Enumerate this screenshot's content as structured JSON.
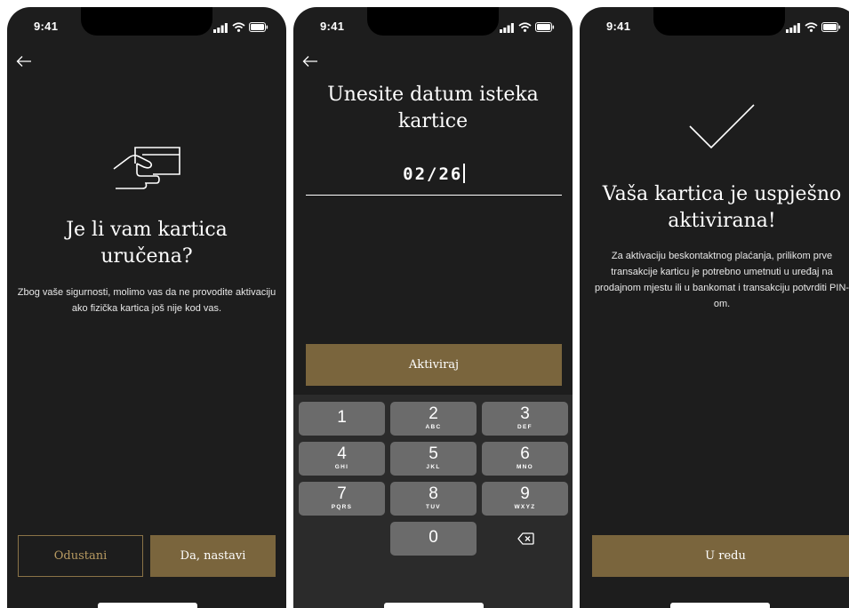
{
  "status_bar": {
    "time": "9:41",
    "icons": [
      "signal-icon",
      "wifi-icon",
      "battery-icon"
    ]
  },
  "colors": {
    "background": "#1d1d1d",
    "accent": "#7a653d",
    "accent_text": "#b79a61",
    "keypad": "#2b2b2b",
    "key": "#6b6b6b"
  },
  "screen1": {
    "icon": "hand-card-icon",
    "title": "Je li vam kartica uručena?",
    "description": "Zbog vaše sigurnosti, molimo vas da ne provodite aktivaciju ako fizička kartica još nije kod vas.",
    "cancel_label": "Odustani",
    "continue_label": "Da, nastavi"
  },
  "screen2": {
    "title": "Unesite datum isteka kartice",
    "date_value": "02/26",
    "activate_label": "Aktiviraj",
    "keypad": [
      {
        "digit": "1",
        "letters": ""
      },
      {
        "digit": "2",
        "letters": "ABC"
      },
      {
        "digit": "3",
        "letters": "DEF"
      },
      {
        "digit": "4",
        "letters": "GHI"
      },
      {
        "digit": "5",
        "letters": "JKL"
      },
      {
        "digit": "6",
        "letters": "MNO"
      },
      {
        "digit": "7",
        "letters": "PQRS"
      },
      {
        "digit": "8",
        "letters": "TUV"
      },
      {
        "digit": "9",
        "letters": "WXYZ"
      },
      {
        "digit": "0",
        "letters": ""
      }
    ],
    "backspace_icon": "backspace-icon"
  },
  "screen3": {
    "icon": "checkmark-icon",
    "title": "Vaša kartica je uspješno aktivirana!",
    "description": "Za aktivaciju beskontaktnog plaćanja, prilikom prve transakcije karticu je potrebno umetnuti u uređaj na prodajnom mjestu ili u bankomat i transakciju potvrditi PIN-om.",
    "ok_label": "U redu"
  }
}
